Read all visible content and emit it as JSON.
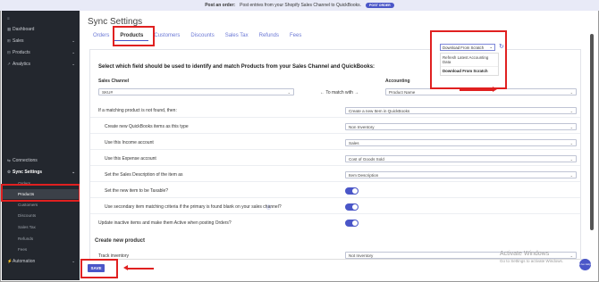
{
  "banner": {
    "prefix": "Post an order:",
    "text": "Post entries from your Shopify Sales Channel to QuickBooks.",
    "button": "POST ORDER"
  },
  "sidebar": {
    "items": [
      {
        "label": "Dashboard"
      },
      {
        "label": "Sales"
      },
      {
        "label": "Products"
      },
      {
        "label": "Analytics"
      }
    ],
    "connections": "Connections",
    "sync_settings": "Sync Settings",
    "sub_items": [
      "Orders",
      "Products",
      "Customers",
      "Discounts",
      "Sales Tax",
      "Refunds",
      "Fees"
    ],
    "automation": "Automation"
  },
  "page": {
    "title": "Sync Settings"
  },
  "tabs": [
    "Orders",
    "Products",
    "Customers",
    "Discounts",
    "Sales Tax",
    "Refunds",
    "Fees"
  ],
  "section": {
    "heading": "Select which field should be used to identify and match Products from your Sales Channel and QuickBooks:",
    "sales_channel_label": "Sales Channel",
    "accounting_label": "Accounting",
    "sales_channel_value": "SKU#",
    "to_match_with": "To match with",
    "accounting_value": "Product Name"
  },
  "dropdown": {
    "selected": "Download From Scratch",
    "options": [
      "Refresh Latest Accounting Data",
      "Download From Scratch"
    ]
  },
  "rows": [
    {
      "label": "If a matching product is not found, then:",
      "value": "Create a new Item in QuickBooks"
    },
    {
      "label": "Create new QuickBooks items as this type",
      "value": "Non Inventory"
    },
    {
      "label": "Use this Income account",
      "value": "Sales"
    },
    {
      "label": "Use this Expense account",
      "value": "Cost of Goods Sold"
    },
    {
      "label": "Set the Sales Description of the item as",
      "value": "Item Description"
    },
    {
      "label": "Set the new item to be Taxable?",
      "value": ""
    },
    {
      "label": "Use secondary item matching criteria if the primary is found blank on your sales channel?",
      "value": ""
    },
    {
      "label": "Update inactive items and make them Active when posting Orders?",
      "value": ""
    }
  ],
  "create_new_product": {
    "heading": "Create new product",
    "track_inventory": "Track inventory",
    "track_value": "Not Inventory"
  },
  "footer": {
    "save": "SAVE"
  },
  "watermark": {
    "title": "Activate Windows",
    "sub": "Go to Settings to activate Windows."
  },
  "livechat": "Live Help",
  "colors": {
    "accent": "#4a56c8",
    "sidebar": "#23272e",
    "highlight": "#e02020"
  }
}
